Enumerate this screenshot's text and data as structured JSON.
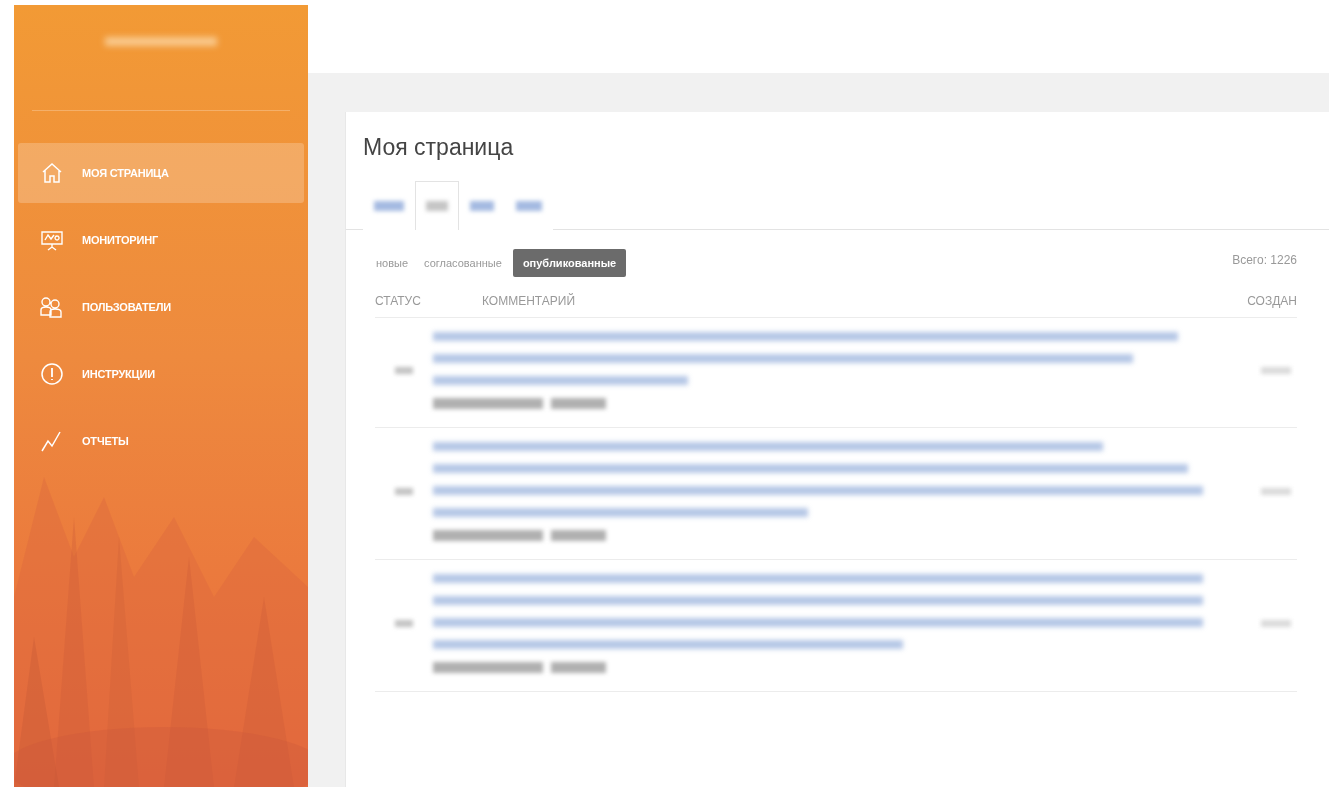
{
  "sidebar": {
    "items": [
      {
        "label": "МОЯ СТРАНИЦА",
        "kind": "home",
        "selected": true
      },
      {
        "label": "МОНИТОРИНГ",
        "kind": "monitor",
        "selected": false
      },
      {
        "label": "ПОЛЬЗОВАТЕЛИ",
        "kind": "users",
        "selected": false
      },
      {
        "label": "ИНСТРУКЦИИ",
        "kind": "info",
        "selected": false
      },
      {
        "label": "ОТЧЕТЫ",
        "kind": "chart",
        "selected": false
      }
    ]
  },
  "page": {
    "title": "Моя страница",
    "tabs": [
      {
        "kind": "redacted",
        "selected": false
      },
      {
        "kind": "redacted",
        "selected": true
      },
      {
        "kind": "redacted",
        "selected": false
      },
      {
        "kind": "redacted",
        "selected": false
      }
    ],
    "filters": [
      {
        "label": "новые",
        "selected": false
      },
      {
        "label": "согласованные",
        "selected": false
      },
      {
        "label": "опубликованные",
        "selected": true
      }
    ],
    "total": "Всего: 1226",
    "table": {
      "columns": [
        "СТАТУС",
        "КОММЕНТАРИЙ",
        "СОЗДАН"
      ],
      "rows": [
        {
          "kind": "redacted"
        },
        {
          "kind": "redacted"
        },
        {
          "kind": "redacted"
        }
      ]
    }
  }
}
